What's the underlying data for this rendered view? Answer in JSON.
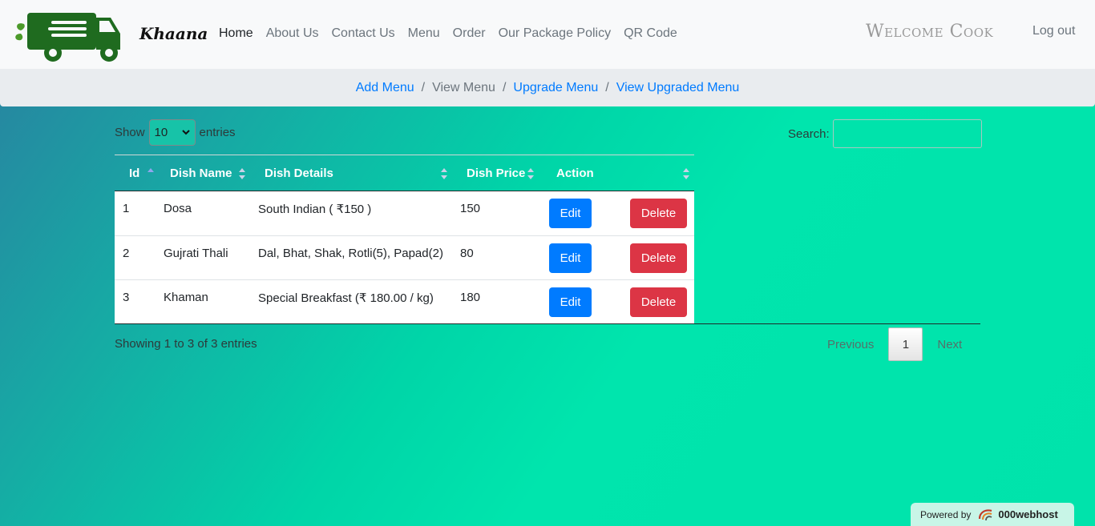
{
  "brand": {
    "name": "Khaana",
    "logo": "food-truck-logo"
  },
  "nav": {
    "links": [
      {
        "label": "Home",
        "active": true
      },
      {
        "label": "About Us"
      },
      {
        "label": "Contact Us"
      },
      {
        "label": "Menu"
      },
      {
        "label": "Order"
      },
      {
        "label": "Our Package Policy"
      },
      {
        "label": "QR Code"
      }
    ],
    "welcome": "Welcome Cook",
    "logout": "Log out"
  },
  "breadcrumb": {
    "items": [
      {
        "label": "Add Menu",
        "link": true
      },
      {
        "label": "View Menu",
        "link": false
      },
      {
        "label": "Upgrade Menu",
        "link": true
      },
      {
        "label": "View Upgraded Menu",
        "link": true
      }
    ],
    "separator": "/"
  },
  "table_controls": {
    "show_label": "Show",
    "entries_value": "10",
    "entries_label": "entries",
    "search_label": "Search:",
    "search_value": ""
  },
  "table": {
    "columns": [
      "Id",
      "Dish Name",
      "Dish Details",
      "Dish Price",
      "Action"
    ],
    "rows": [
      {
        "id": "1",
        "name": "Dosa",
        "details": "South Indian ( ₹150 )",
        "price": "150"
      },
      {
        "id": "2",
        "name": "Gujrati Thali",
        "details": "Dal, Bhat, Shak, Rotli(5), Papad(2)",
        "price": "80"
      },
      {
        "id": "3",
        "name": "Khaman",
        "details": "Special Breakfast (₹ 180.00 / kg)",
        "price": "180"
      }
    ],
    "edit_label": "Edit",
    "delete_label": "Delete"
  },
  "footer": {
    "info": "Showing 1 to 3 of 3 entries",
    "previous": "Previous",
    "page": "1",
    "next": "Next"
  },
  "powered": {
    "prefix": "Powered by",
    "name": "000webhost"
  },
  "colors": {
    "primary": "#007bff",
    "danger": "#dc3545",
    "logo_green": "#1f6b1f",
    "bg_teal": "#00e3ab"
  }
}
